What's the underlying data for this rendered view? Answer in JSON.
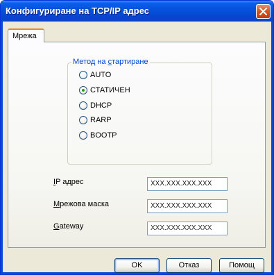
{
  "window": {
    "title": "Конфигуриране на TCP/IP адрес",
    "close_icon": "close-icon"
  },
  "tabs": [
    {
      "label": "Мрежа",
      "active": true
    }
  ],
  "boot_method": {
    "label_prefix": "Метод на ",
    "label_mnemonic": "с",
    "label_suffix": "тартиране",
    "options": [
      {
        "label": "AUTO",
        "selected": false
      },
      {
        "label": "СТАТИЧЕН",
        "selected": true
      },
      {
        "label": "DHCP",
        "selected": false
      },
      {
        "label": "RARP",
        "selected": false
      },
      {
        "label": "BOOTP",
        "selected": false
      }
    ]
  },
  "fields": {
    "ip": {
      "mnemonic": "I",
      "label_rest": "P адрес",
      "value": "XXX.XXX.XXX.XXX"
    },
    "mask": {
      "mnemonic": "М",
      "label_rest": "режова маска",
      "value": "XXX.XXX.XXX.XXX"
    },
    "gateway": {
      "mnemonic": "G",
      "label_rest": "ateway",
      "value": "XXX.XXX.XXX.XXX"
    }
  },
  "buttons": {
    "ok": "OK",
    "cancel": "Отказ",
    "help": "Помощ"
  },
  "colors": {
    "titlebar": "#0653de",
    "group_label": "#0046d5",
    "radio_selected": "#21a121",
    "tab_highlight": "#e68b2c"
  }
}
